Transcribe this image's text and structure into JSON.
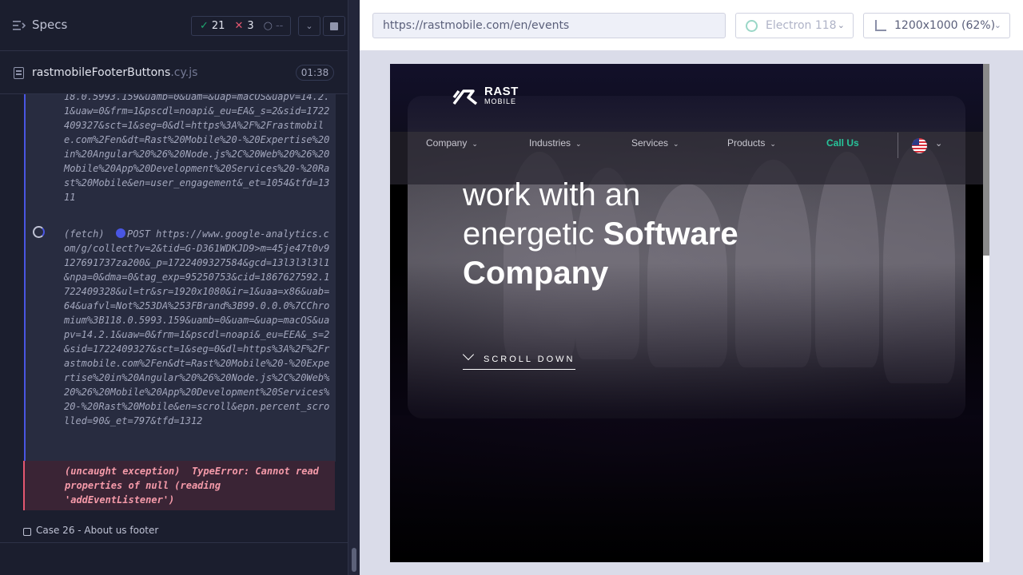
{
  "runner": {
    "title": "Specs",
    "stats": {
      "passed": "21",
      "failed": "3",
      "pending": "--",
      "pass_glyph": "✓",
      "fail_glyph": "✕",
      "pending_glyph": "○"
    },
    "spec_file": {
      "name": "rastmobileFooterButtons",
      "ext": ".cy.js",
      "duration": "01:38"
    },
    "log": {
      "prev_tail": "18.0.5993.159&uamb=0&uam=&uap=macOS&uapv=14.2.1&uaw=0&frm=1&pscdl=noapi&_eu=EA&_s=2&sid=1722409327&sct=1&seg=0&dl=https%3A%2F%2Frastmobile.com%2Fen&dt=Rast%20Mobile%20-%20Expertise%20in%20Angular%20%26%20Node.js%2C%20Web%20%26%20Mobile%20App%20Development%20Services%20-%20Rast%20Mobile&en=user_engagement&_et=1054&tfd=1311",
      "fetch_label": "(fetch)",
      "fetch_method": "POST",
      "fetch_url": "https://www.google-analytics.com/g/collect?v=2&tid=G-D361WDKJD9>m=45je47t0v9127691737za200&_p=1722409327584&gcd=13l3l3l3l1&npa=0&dma=0&tag_exp=95250753&cid=1867627592.1722409328&ul=tr&sr=1920x1080&ir=1&uaa=x86&uab=64&uafvl=Not%253DA%253FBrand%3B99.0.0.0%7CChromium%3B118.0.5993.159&uamb=0&uam=&uap=macOS&uapv=14.2.1&uaw=0&frm=1&pscdl=noapi&_eu=EEA&_s=2&sid=1722409327&sct=1&seg=0&dl=https%3A%2F%2Frastmobile.com%2Fen&dt=Rast%20Mobile%20-%20Expertise%20in%20Angular%20%26%20Node.js%2C%20Web%20%26%20Mobile%20App%20Development%20Services%20-%20Rast%20Mobile&en=scroll&epn.percent_scrolled=90&_et=797&tfd=1312",
      "error_label": "(uncaught exception)",
      "error_message": "TypeError: Cannot read properties of null (reading 'addEventListener')"
    },
    "case_label": "Case 26 - About us footer"
  },
  "browser": {
    "url": "https://rastmobile.com/en/events",
    "browser_name": "Electron 118",
    "viewport": "1200x1000",
    "zoom": "(62%)"
  },
  "site": {
    "logo_top": "RAST",
    "logo_bottom": "MOBILE",
    "nav": {
      "company": "Company",
      "industries": "Industries",
      "services": "Services",
      "products": "Products",
      "call_us": "Call Us"
    },
    "hero": {
      "line1": "work with an",
      "line2_normal": "energetic ",
      "line2_bold": "Software",
      "line3_bold": "Company"
    },
    "scroll_down": "SCROLL DOWN"
  },
  "colors": {
    "accent": "#4956e3",
    "pass": "#1fa971",
    "fail": "#e45770",
    "call_us": "#27c39a"
  }
}
